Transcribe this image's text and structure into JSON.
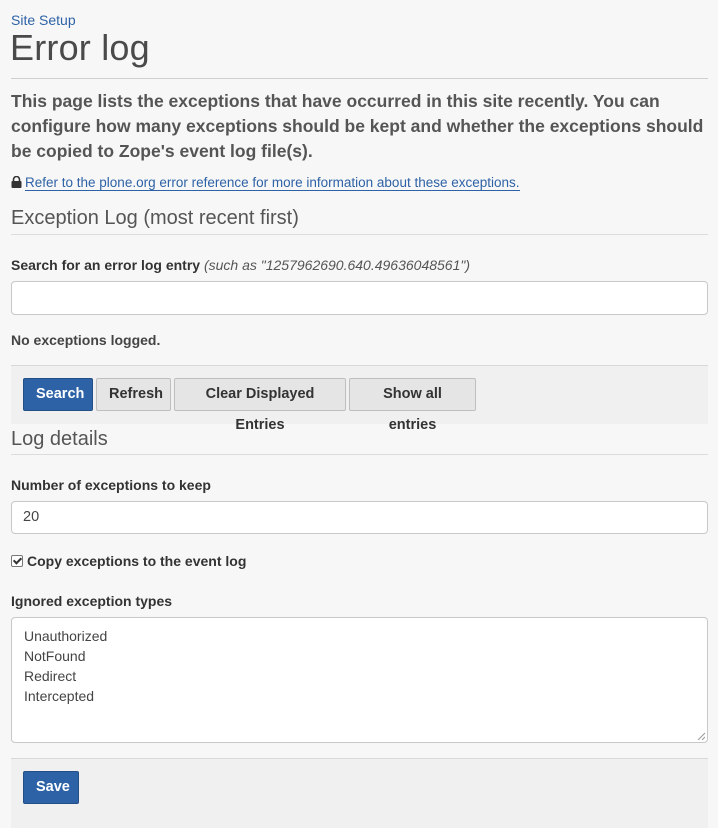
{
  "breadcrumb": "Site Setup",
  "page_title": "Error log",
  "lead_text": "This page lists the exceptions that have occurred in this site recently. You can configure how many exceptions should be kept and whether the exceptions should be copied to Zope's event log file(s).",
  "reference_link": "Refer to the plone.org error reference for more information about these exceptions.",
  "exception_log": {
    "legend": "Exception Log (most recent first)",
    "search_label": "Search for an error log entry",
    "search_hint": "(such as \"1257962690.640.49636048561\")",
    "search_value": "",
    "status": "No exceptions logged."
  },
  "buttons": {
    "search": "Search",
    "refresh": "Refresh",
    "clear": "Clear Displayed Entries",
    "show_all": "Show all entries",
    "save": "Save"
  },
  "log_details": {
    "legend": "Log details",
    "keep_label": "Number of exceptions to keep",
    "keep_value": "20",
    "copy_label": "Copy exceptions to the event log",
    "copy_checked": true,
    "ignored_label": "Ignored exception types",
    "ignored_types": [
      "Unauthorized",
      "NotFound",
      "Redirect",
      "Intercepted"
    ]
  },
  "colors": {
    "link": "#2e62a6",
    "primary_button": "#2e62a6",
    "background": "#f7f7f7"
  }
}
